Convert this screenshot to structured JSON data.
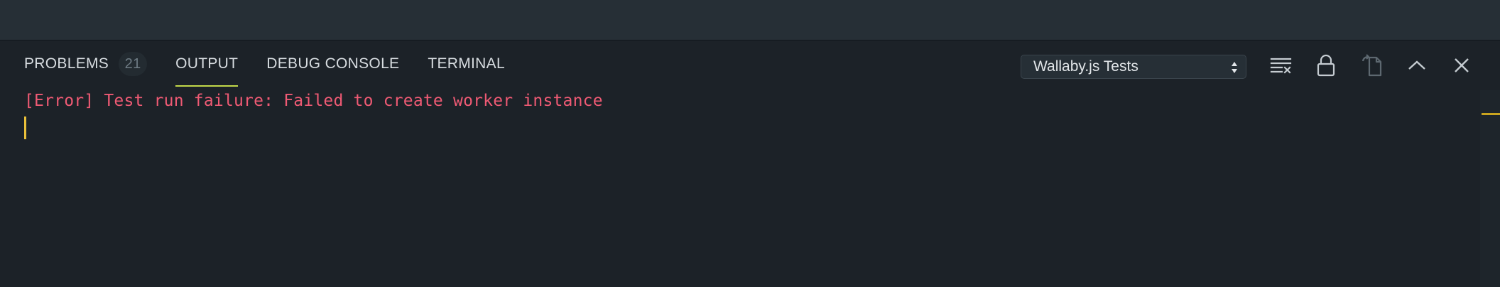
{
  "panel": {
    "tabs": [
      {
        "label": "PROBLEMS",
        "badge": "21"
      },
      {
        "label": "OUTPUT"
      },
      {
        "label": "DEBUG CONSOLE"
      },
      {
        "label": "TERMINAL"
      }
    ],
    "active_tab": "OUTPUT",
    "channel_select": {
      "selected": "Wallaby.js Tests"
    },
    "actions": [
      {
        "icon": "clear-output-icon"
      },
      {
        "icon": "lock-icon"
      },
      {
        "icon": "open-in-editor-icon"
      },
      {
        "icon": "chevron-up-icon"
      },
      {
        "icon": "close-icon"
      }
    ]
  },
  "output": {
    "lines": [
      "[Error] Test run failure: Failed to create worker instance"
    ]
  },
  "colors": {
    "error_text": "#ef5a74",
    "active_tab_underline": "#c3d94a",
    "cursor": "#e9c03a",
    "background": "#1c2228"
  }
}
